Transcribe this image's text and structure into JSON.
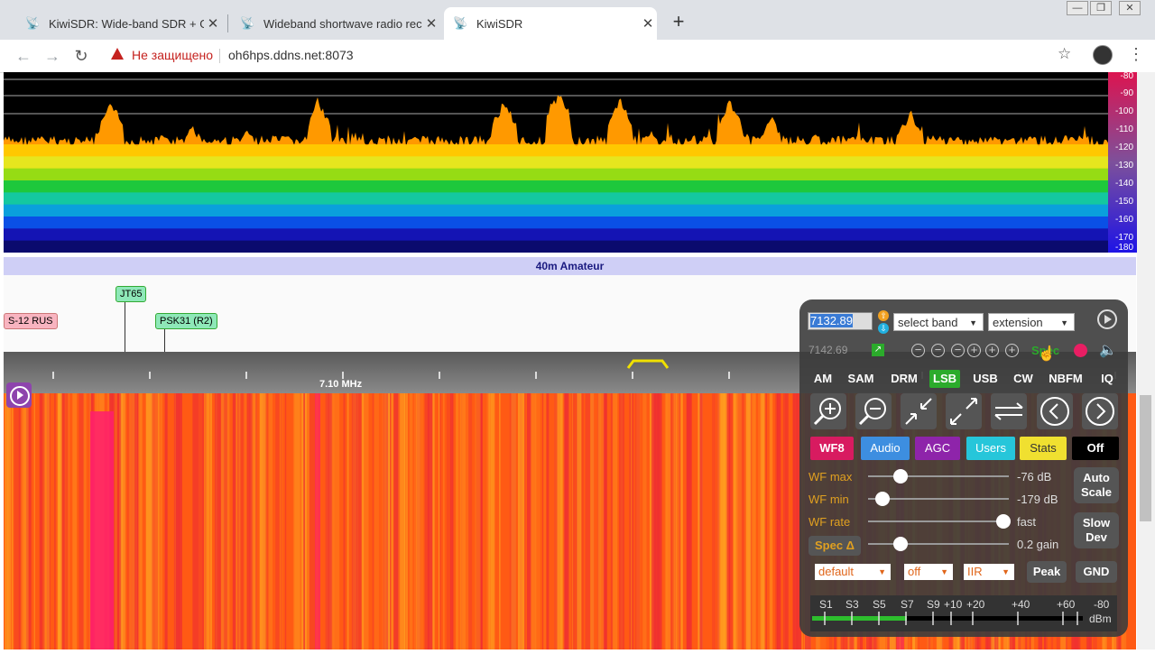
{
  "browser": {
    "tabs": [
      {
        "title": "KiwiSDR: Wide-band SDR + GPS",
        "active": false
      },
      {
        "title": "Wideband shortwave radio recei",
        "active": false
      },
      {
        "title": "KiwiSDR",
        "active": true
      }
    ],
    "new_tab": "+",
    "security_warning": "Не защищено",
    "url": "oh6hps.ddns.net:8073",
    "window_controls": {
      "minimize": "—",
      "maximize": "❐",
      "close": "✕"
    }
  },
  "spectrum": {
    "db_labels": [
      "-80",
      "-90",
      "-100",
      "-110",
      "-120",
      "-130",
      "-140",
      "-150",
      "-160",
      "-170",
      "-180"
    ],
    "band_colors": [
      "#ff9900",
      "#ffc800",
      "#e6e61e",
      "#96dc14",
      "#1ec83c",
      "#14c8a0",
      "#0aa0dc",
      "#0a50e6",
      "#1414b4",
      "#0a0a6e"
    ]
  },
  "band_name": "40m Amateur",
  "dx_labels": [
    {
      "text": "S-12 RUS",
      "color": "#f8b4c0"
    },
    {
      "text": "JT65",
      "color": "#8ee8b8"
    },
    {
      "text": "PSK31 (R2)",
      "color": "#8ee8b8"
    }
  ],
  "scale": {
    "freq_label": "7.10 MHz"
  },
  "panel": {
    "freq_input": "7132.89",
    "select_band": "select band",
    "extension": "extension",
    "freq_b": "7142.69",
    "spec_label": "Spec",
    "modes": [
      "AM",
      "SAM",
      "DRM",
      "LSB",
      "USB",
      "CW",
      "NBFM",
      "IQ"
    ],
    "active_mode": "LSB",
    "tab_buttons": [
      {
        "label": "WF8",
        "color": "#d81b60"
      },
      {
        "label": "Audio",
        "color": "#3d8ee0"
      },
      {
        "label": "AGC",
        "color": "#8e24aa"
      },
      {
        "label": "Users",
        "color": "#26c6da"
      },
      {
        "label": "Stats",
        "color": "#f0e030"
      },
      {
        "label": "Off",
        "color": "#000000"
      }
    ],
    "sliders": [
      {
        "label": "WF max",
        "value": "-76 dB",
        "level": 0.23
      },
      {
        "label": "WF min",
        "value": "-179 dB",
        "level": 0.1
      },
      {
        "label": "WF rate",
        "value": "fast",
        "level": 0.96
      },
      {
        "label": "Spec Δ",
        "value": "0.2 gain",
        "level": 0.23
      }
    ],
    "auto_scale": "Auto Scale",
    "slow_dev": "Slow Dev",
    "selects": [
      "default",
      "off",
      "IIR"
    ],
    "peak": "Peak",
    "gnd": "GND",
    "smeter_labels": [
      "S1",
      "S3",
      "S5",
      "S7",
      "S9",
      "+10",
      "+20",
      "+40",
      "+60",
      "-80"
    ],
    "smeter_unit": "dBm",
    "smeter_level": 0.35
  }
}
